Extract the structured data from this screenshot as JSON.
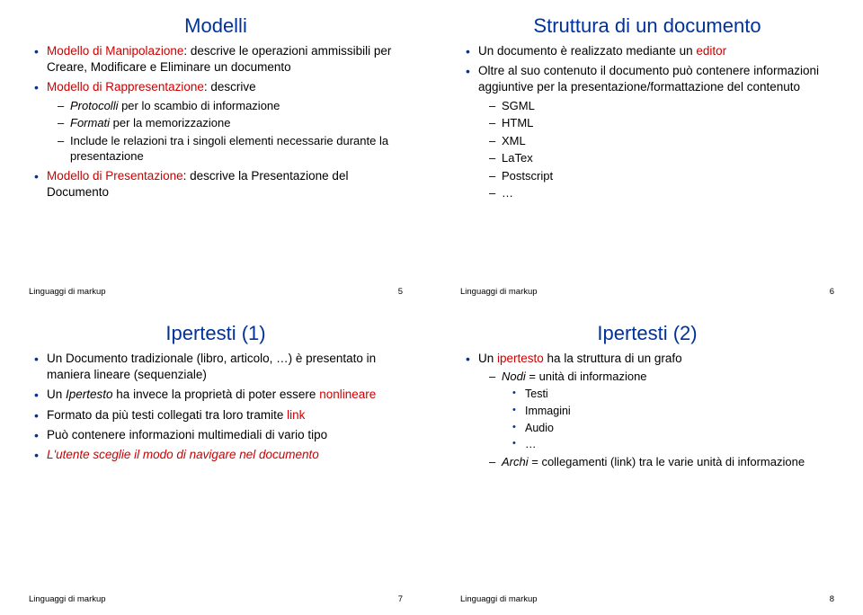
{
  "footer_label": "Linguaggi di markup",
  "slides": [
    {
      "title": "Modelli",
      "page": "5",
      "b1_pre": "Modello di Manipolazione",
      "b1_post": ": descrive le operazioni ammissibili per Creare, Modificare e Eliminare un documento",
      "b2_pre": "Modello di Rappresentazione",
      "b2_post": ": descrive",
      "b2_sub1_pre": "Protocolli",
      "b2_sub1_post": " per lo scambio di informazione",
      "b2_sub2_pre": "Formati",
      "b2_sub2_post": " per la memorizzazione",
      "b2_sub3": "Include le relazioni tra i singoli elementi necessarie durante la presentazione",
      "b3_pre": "Modello di Presentazione",
      "b3_post": ": descrive la Presentazione del Documento"
    },
    {
      "title": "Struttura di un documento",
      "page": "6",
      "s1_pre": "Un documento è realizzato mediante un ",
      "s1_red": "editor",
      "s2": "Oltre al suo contenuto il documento può contenere informazioni aggiuntive per la presentazione/formattazione del contenuto",
      "sub": [
        "SGML",
        "HTML",
        "XML",
        "LaTex",
        "Postscript",
        "…"
      ]
    },
    {
      "title": "Ipertesti (1)",
      "page": "7",
      "l1": "Un Documento tradizionale (libro, articolo, …) è presentato in maniera lineare (sequenziale)",
      "l2_pre": "Un ",
      "l2_it": "Ipertesto",
      "l2_mid": " ha invece la proprietà di poter essere ",
      "l2_red": "nonlineare",
      "l3_pre": "Formato da più testi collegati tra loro tramite ",
      "l3_red": "link",
      "l4": "Può contenere informazioni multimediali di vario tipo",
      "l5_it": "L'utente sceglie il modo di navigare nel documento"
    },
    {
      "title": "Ipertesti (2)",
      "page": "8",
      "r1_pre": "Un ",
      "r1_red": "ipertesto",
      "r1_post": " ha la struttura di un grafo",
      "r1_sub1_pre": "Nodi",
      "r1_sub1_post": " = unità di informazione",
      "r1_sub1_items": [
        "Testi",
        "Immagini",
        "Audio",
        "…"
      ],
      "r1_sub2_pre": "Archi",
      "r1_sub2_post": " = collegamenti (link) tra le varie unità di informazione"
    }
  ]
}
